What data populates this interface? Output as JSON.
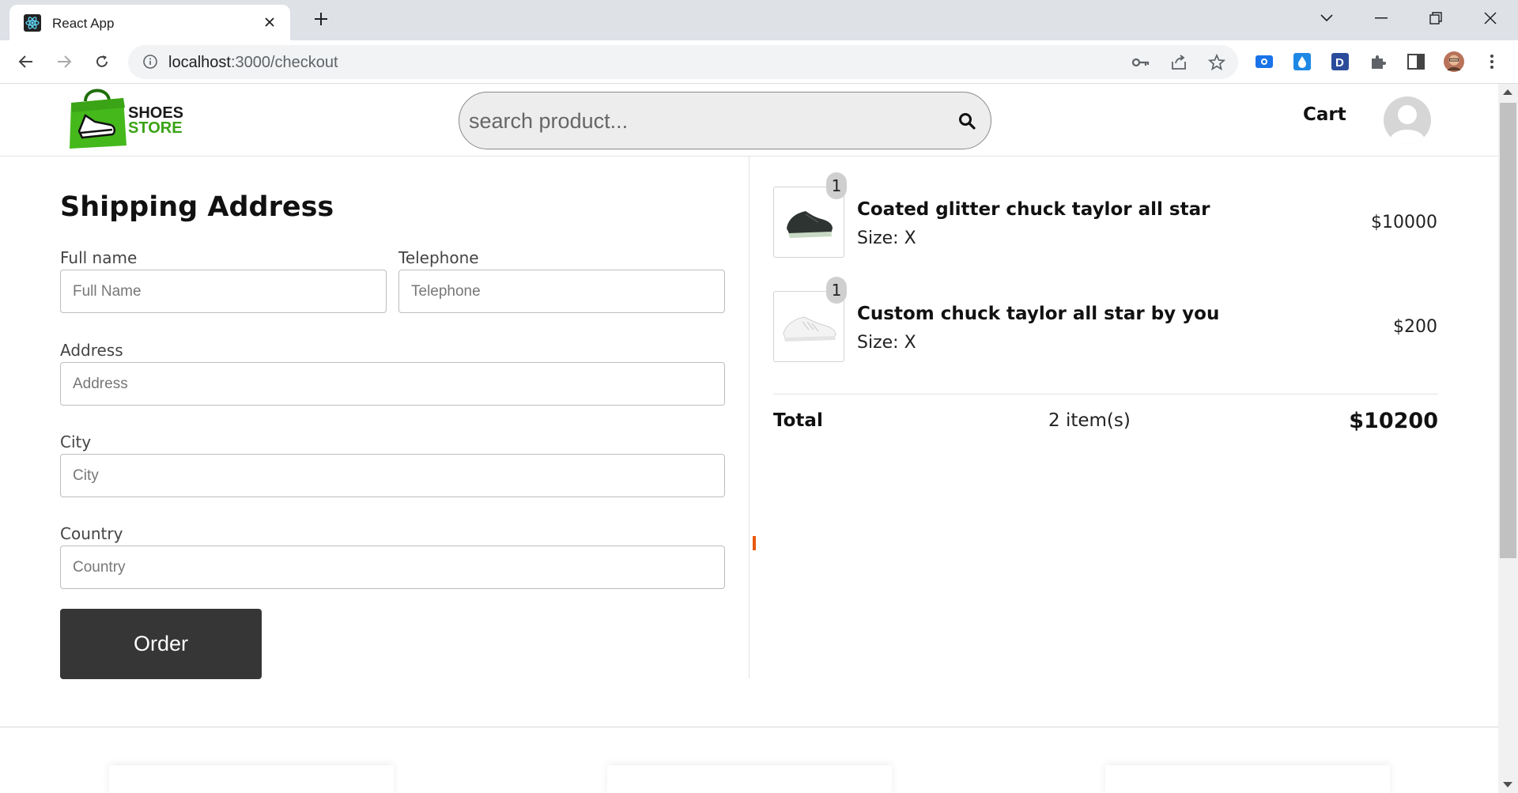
{
  "browser": {
    "tab_title": "React App",
    "url_host": "localhost",
    "url_path": ":3000/checkout"
  },
  "header": {
    "logo_line1": "SHOES",
    "logo_line2": "STORE",
    "search_placeholder": "search product...",
    "cart_label": "Cart"
  },
  "form": {
    "title": "Shipping Address",
    "fullname_label": "Full name",
    "fullname_placeholder": "Full Name",
    "telephone_label": "Telephone",
    "telephone_placeholder": "Telephone",
    "address_label": "Address",
    "address_placeholder": "Address",
    "city_label": "City",
    "city_placeholder": "City",
    "country_label": "Country",
    "country_placeholder": "Country",
    "order_button": "Order"
  },
  "summary": {
    "items": [
      {
        "qty": "1",
        "name": "Coated glitter chuck taylor all star",
        "size": "Size: X",
        "price": "$10000",
        "shoe_color": "dark"
      },
      {
        "qty": "1",
        "name": "Custom chuck taylor all star by you",
        "size": "Size: X",
        "price": "$200",
        "shoe_color": "white"
      }
    ],
    "total_label": "Total",
    "total_count": "2 item(s)",
    "total_amount": "$10200"
  },
  "colors": {
    "brand_green": "#3aa316",
    "order_button": "#363636"
  }
}
